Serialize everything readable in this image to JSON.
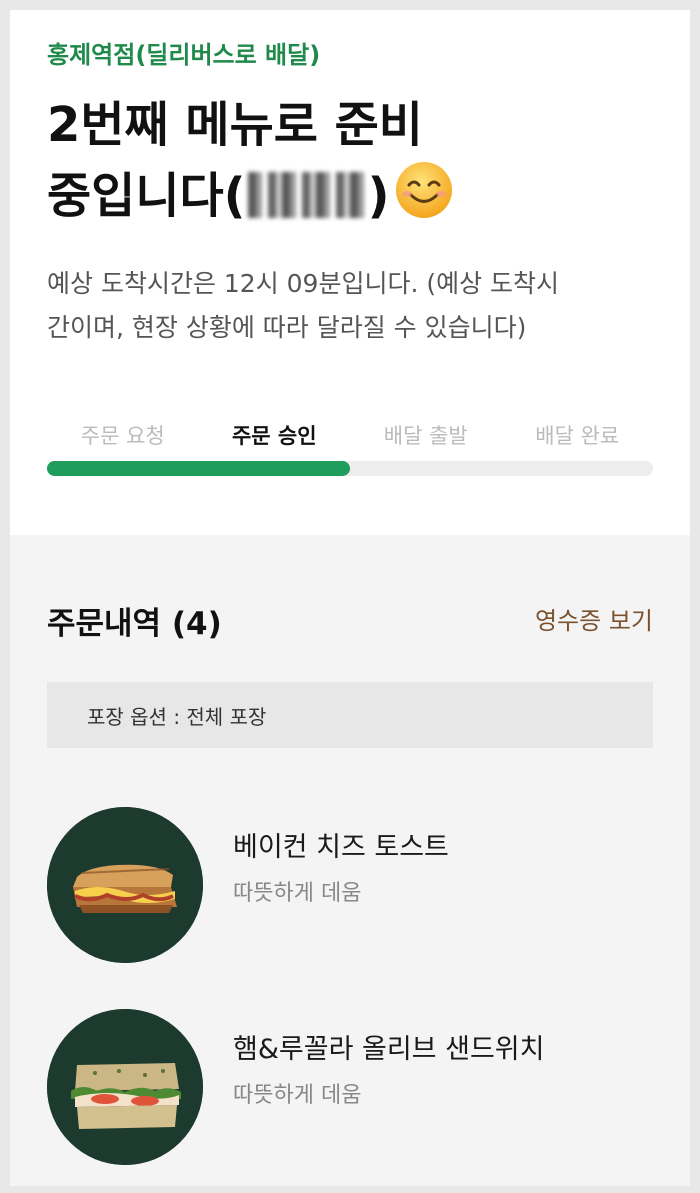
{
  "status": {
    "store_name": "홍제역점(딜리버스로 배달)",
    "title_line1": "2번째 메뉴로 준비",
    "title_line2_prefix": "중입니다(",
    "title_line2_suffix": ")",
    "eta_text": "예상 도착시간은 12시 09분입니다. (예상 도착시간이며, 현장 상황에 따라 달라질 수 있습니다)"
  },
  "progress": {
    "steps": [
      "주문 요청",
      "주문 승인",
      "배달 출발",
      "배달 완료"
    ],
    "active_index": 1,
    "fraction": 0.5,
    "fill_color": "#1e9e5a"
  },
  "order": {
    "heading": "주문내역 (4)",
    "receipt_link": "영수증 보기",
    "pack_option": "포장 옵션 : 전체 포장",
    "items": [
      {
        "name": "베이컨 치즈 토스트",
        "option": "따뜻하게 데움",
        "icon": "toast-image"
      },
      {
        "name": "햄&루꼴라 올리브 샌드위치",
        "option": "따뜻하게 데움",
        "icon": "sandwich-image"
      }
    ]
  },
  "colors": {
    "accent": "#1f8a4c",
    "receipt": "#7a5230",
    "thumb_bg": "#1d3a2e"
  }
}
